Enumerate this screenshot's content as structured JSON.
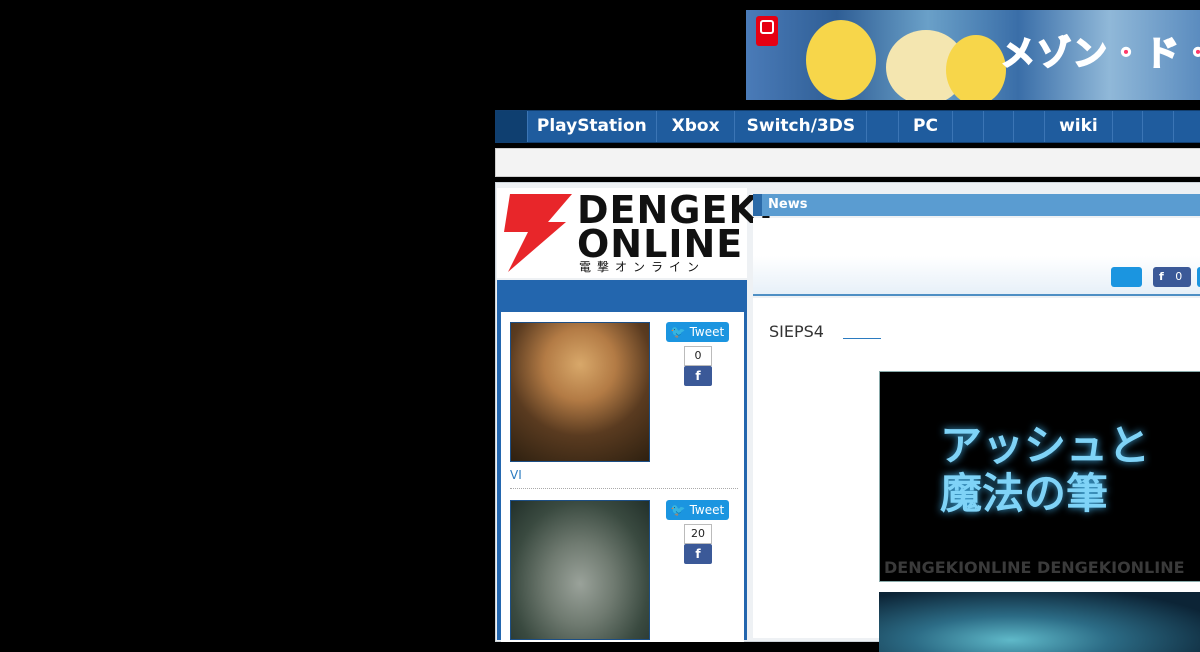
{
  "banner": {
    "text": "メゾン・ド・"
  },
  "nav": {
    "items": [
      {
        "label": ""
      },
      {
        "label": "PlayStation"
      },
      {
        "label": "Xbox"
      },
      {
        "label": "Switch/3DS"
      },
      {
        "label": ""
      },
      {
        "label": "PC"
      },
      {
        "label": ""
      },
      {
        "label": ""
      },
      {
        "label": ""
      },
      {
        "label": "wiki"
      },
      {
        "label": ""
      },
      {
        "label": ""
      },
      {
        "label": ""
      }
    ]
  },
  "logo": {
    "line1": "DENGEKI",
    "line2": "ONLINE",
    "kana": "電撃オンライン"
  },
  "ranking": {
    "items": [
      {
        "tweet_label": "Tweet",
        "fb_count": "0",
        "title": "VI"
      },
      {
        "tweet_label": "Tweet",
        "fb_count": "20",
        "title": ""
      }
    ]
  },
  "news": {
    "tab_label": "News",
    "fb_count": "0"
  },
  "article": {
    "text": "SIEPS4",
    "image_title": "アッシュと\n魔法の筆",
    "watermark": "DENGEKIONLINE DENGEKIONLINE"
  }
}
